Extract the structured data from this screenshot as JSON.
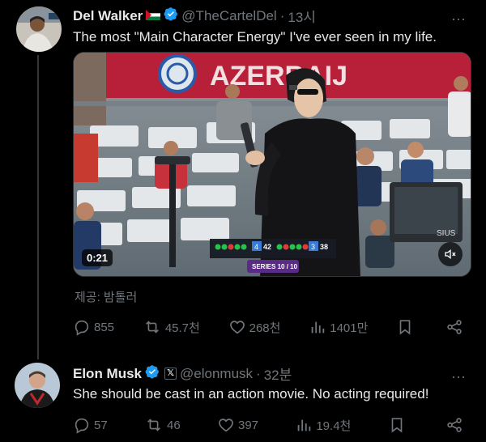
{
  "tweets": [
    {
      "name": "Del Walker",
      "flag": "🇵🇸",
      "handle": "@TheCartelDel",
      "time": "13시",
      "text": "The most \"Main Character Energy\" I've ever seen in my life.",
      "media": {
        "duration": "0:21",
        "banner_text": "AZERBAIJ",
        "scoreboard_series": "SERIES 10 / 10",
        "score_left": "42",
        "score_right": "38",
        "score_left_index": "4",
        "score_right_index": "3",
        "monitor_label": "SIUS"
      },
      "provided_by": "제공: 밤톨러",
      "stats": {
        "replies": "855",
        "reposts": "45.7천",
        "likes": "268천",
        "views": "1401만"
      }
    },
    {
      "name": "Elon Musk",
      "badge": "𝕏",
      "handle": "@elonmusk",
      "time": "32분",
      "text": "She should be cast in an action movie. No  acting required!",
      "stats": {
        "replies": "57",
        "reposts": "46",
        "likes": "397",
        "views": "19.4천"
      }
    }
  ],
  "colors": {
    "text": "#e7e9ea",
    "muted": "#71767b",
    "verified": "#1d9bf0",
    "background": "#000000"
  }
}
